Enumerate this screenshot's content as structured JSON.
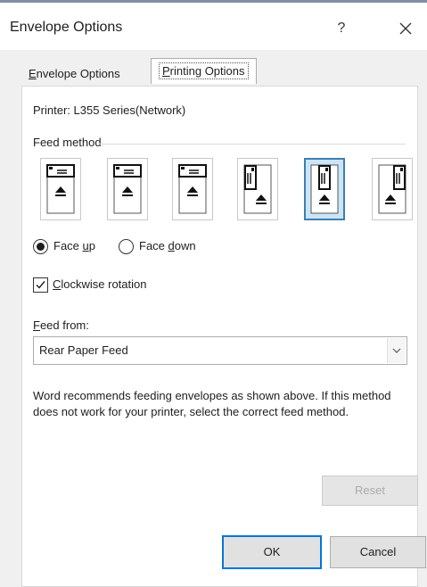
{
  "window": {
    "title": "Envelope Options",
    "help_label": "?",
    "close_icon": "close-icon"
  },
  "tabs": [
    {
      "label": "Envelope Options",
      "mnemonic": "E",
      "rest": "nvelope Options",
      "active": false
    },
    {
      "label": "Printing Options",
      "mnemonic": "P",
      "rest": "rinting Options",
      "active": true
    }
  ],
  "printer": {
    "text": "Printer:  L355 Series(Network)"
  },
  "feed_method": {
    "label": "Feed method",
    "options": [
      {
        "name": "feed-option-1",
        "icon": "envelope-landscape-left-icon",
        "selected": false
      },
      {
        "name": "feed-option-2",
        "icon": "envelope-landscape-center-icon",
        "selected": false
      },
      {
        "name": "feed-option-3",
        "icon": "envelope-landscape-right-icon",
        "selected": false
      },
      {
        "name": "feed-option-4",
        "icon": "envelope-portrait-left-icon",
        "selected": false
      },
      {
        "name": "feed-option-5",
        "icon": "envelope-portrait-center-icon",
        "selected": true
      },
      {
        "name": "feed-option-6",
        "icon": "envelope-portrait-right-icon",
        "selected": false
      }
    ]
  },
  "face": {
    "up_label": "Face up",
    "up_mnemonic": "u",
    "down_label": "Face down",
    "down_mnemonic": "d",
    "selected": "up"
  },
  "clockwise": {
    "label": "Clockwise rotation",
    "mnemonic": "C",
    "checked": true
  },
  "feed_from": {
    "label": "Feed from:",
    "mnemonic": "F",
    "value": "Rear Paper Feed"
  },
  "description": "Word recommends feeding envelopes as shown above. If this method does not work for your printer, select the correct feed method.",
  "buttons": {
    "reset": "Reset",
    "ok": "OK",
    "cancel": "Cancel"
  },
  "colors": {
    "accent": "#0078d7",
    "selected_bg": "#cce4f7"
  }
}
